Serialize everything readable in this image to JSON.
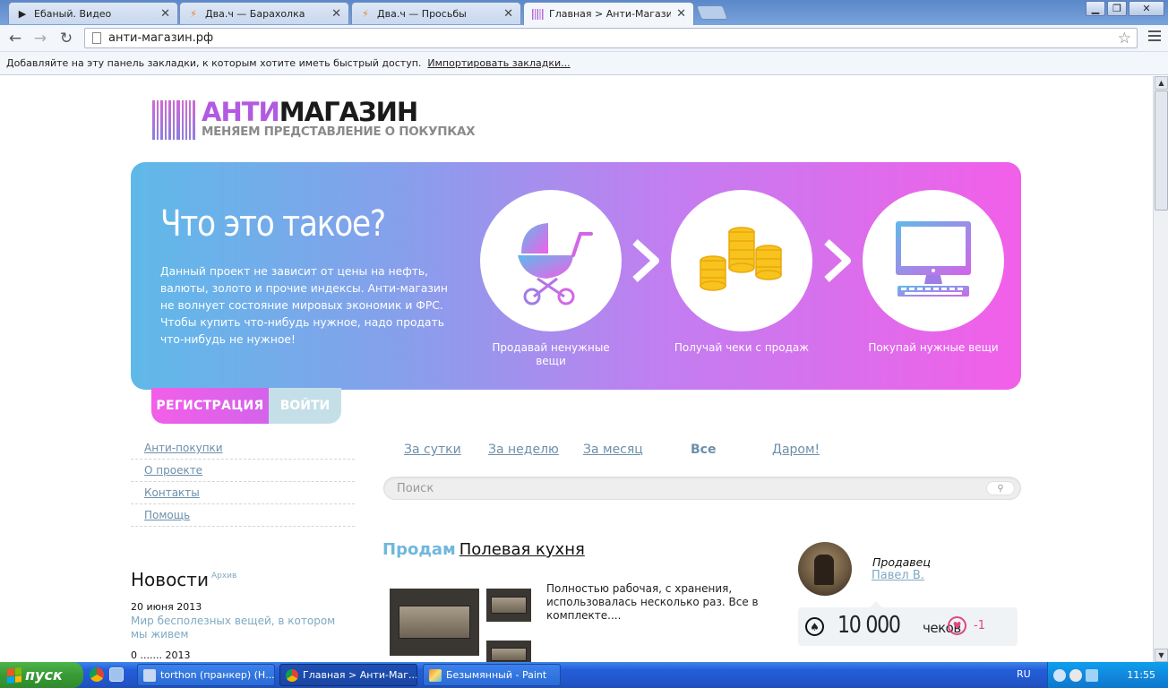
{
  "browser": {
    "tabs": [
      {
        "label": "Ебаный. Видео",
        "active": false
      },
      {
        "label": "Два.ч — Барахолка",
        "active": false
      },
      {
        "label": "Два.ч — Просьбы",
        "active": false
      },
      {
        "label": "Главная > Анти-Магазин",
        "active": true
      }
    ],
    "url": "анти-магазин.рф",
    "bookmark_hint": "Добавляйте на эту панель закладки, к которым хотите иметь быстрый доступ.",
    "bookmark_import": "Импортировать закладки..."
  },
  "site": {
    "logo_anti": "АНТИ",
    "logo_shop": "МАГАЗИН",
    "tagline": "МЕНЯЕМ ПРЕДСТАВЛЕНИЕ О ПОКУПКАХ",
    "hero": {
      "title": "Что это такое?",
      "desc1": "Данный проект не зависит от цены на нефть, валюты, золото и прочие индексы. Анти-магазин не волнует состояние мировых экономик и ФРС.",
      "desc2": "Чтобы купить что-нибудь нужное, надо продать что-нибудь не нужное!",
      "steps": [
        {
          "label": "Продавай ненужные вещи",
          "icon": "stroller-icon"
        },
        {
          "label": "Получай чеки с продаж",
          "icon": "coins-icon"
        },
        {
          "label": "Покупай нужные вещи",
          "icon": "computer-icon"
        }
      ]
    },
    "auth": {
      "register": "РЕГИСТРАЦИЯ",
      "login": "ВОЙТИ"
    },
    "sidenav": [
      "Анти-покупки",
      "О проекте",
      "Контакты",
      "Помощь"
    ],
    "news": {
      "heading": "Новости",
      "archive": "Архив",
      "date": "20 июня 2013",
      "link": "Мир бесполезных вещей, в котором мы живем",
      "date2": "0 ....... 2013"
    },
    "filters": [
      "За сутки",
      "За неделю",
      "За месяц",
      "Все",
      "Даром!"
    ],
    "active_filter": "Все",
    "search_placeholder": "Поиск",
    "listing": {
      "sell_label": "Продам",
      "title": "Полевая кухня",
      "description": "Полностью рабочая, с хранения, использовалась несколько раз. Все в комплекте...."
    },
    "seller": {
      "role": "Продавец",
      "name": "Павел В.",
      "checks_value": "10 000",
      "checks_unit": "чеков",
      "rating": "-1"
    }
  },
  "taskbar": {
    "start": "пуск",
    "tasks": [
      {
        "label": "torthon (пранкер) (Н...",
        "active": false
      },
      {
        "label": "Главная > Анти-Маг...",
        "active": true
      },
      {
        "label": "Безымянный - Paint",
        "active": false
      }
    ],
    "lang": "RU",
    "clock": "11:55"
  },
  "colors": {
    "brand_purple": "#b25ae0",
    "hero_start": "#5fb9e9",
    "hero_end": "#f25fe8",
    "link_blue": "#6d8faa",
    "accent_pink": "#e0457f"
  }
}
